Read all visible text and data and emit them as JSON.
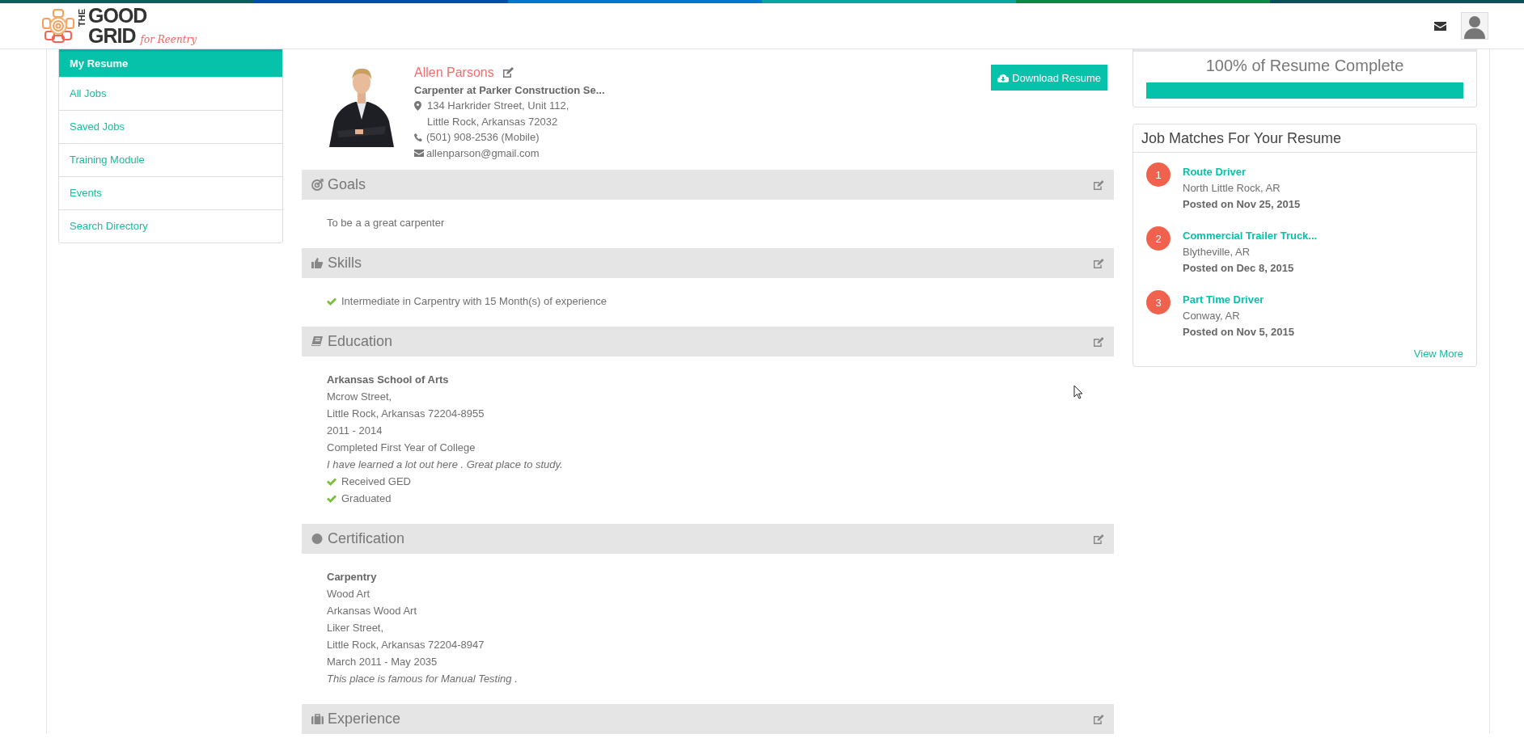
{
  "header": {
    "logo": {
      "word_1": "THE",
      "word_2": "GOOD",
      "word_3": "GRID",
      "tagline": "for Reentry"
    }
  },
  "sidebar": {
    "items": [
      {
        "label": "My Resume",
        "selected": true
      },
      {
        "label": "All Jobs",
        "selected": false
      },
      {
        "label": "Saved Jobs",
        "selected": false
      },
      {
        "label": "Training Module",
        "selected": false
      },
      {
        "label": "Events",
        "selected": false
      },
      {
        "label": "Search Directory",
        "selected": false
      }
    ]
  },
  "profile": {
    "name": "Allen Parsons",
    "headline": "Carpenter at Parker Construction Se...",
    "address_line_1": "134 Harkrider Street, Unit 112,",
    "address_line_2": "Little Rock, Arkansas  72032",
    "phone": "(501) 908-2536 (Mobile)",
    "email": "allenparson@gmail.com",
    "download_button": "Download Resume"
  },
  "sections": [
    {
      "kind": "goals",
      "title": "Goals",
      "entries": [
        {
          "kind": "plain",
          "text": "To be a a great carpenter"
        }
      ]
    },
    {
      "kind": "skills",
      "title": "Skills",
      "entries": [
        {
          "kind": "check",
          "text": "Intermediate in Carpentry with 15  Month(s) of experience"
        }
      ]
    },
    {
      "kind": "education",
      "title": "Education",
      "entries": [
        {
          "kind": "heading",
          "text": "Arkansas School of Arts"
        },
        {
          "kind": "plain",
          "text": "Mcrow Street,"
        },
        {
          "kind": "plain",
          "text": "Little Rock, Arkansas  72204-8955"
        },
        {
          "kind": "plain",
          "text": "2011 - 2014"
        },
        {
          "kind": "plain",
          "text": "Completed First Year of College"
        },
        {
          "kind": "note",
          "text": "I have learned a lot out here . Great place to study."
        },
        {
          "kind": "check",
          "text": "Received GED"
        },
        {
          "kind": "check",
          "text": "Graduated"
        }
      ]
    },
    {
      "kind": "certification",
      "title": "Certification",
      "entries": [
        {
          "kind": "heading",
          "text": "Carpentry"
        },
        {
          "kind": "plain",
          "text": "Wood Art"
        },
        {
          "kind": "plain",
          "text": "Arkansas Wood Art"
        },
        {
          "kind": "plain",
          "text": "Liker Street,"
        },
        {
          "kind": "plain",
          "text": "Little Rock, Arkansas  72204-8947"
        },
        {
          "kind": "plain",
          "text": "March 2011 - May 2035"
        },
        {
          "kind": "note",
          "text": "This place is famous for Manual Testing ."
        }
      ]
    },
    {
      "kind": "experience",
      "title": "Experience"
    }
  ],
  "resume_complete": {
    "label": "100% of Resume Complete",
    "level": 1
  },
  "job_matches": {
    "title": "Job Matches For Your Resume",
    "jobs": [
      {
        "number": "1",
        "title": "Route Driver",
        "location": "North Little Rock, AR",
        "posted": "Posted on Nov 25, 2015"
      },
      {
        "number": "2",
        "title": "Commercial Trailer Truck...",
        "location": "Blytheville, AR",
        "posted": "Posted on Dec 8, 2015"
      },
      {
        "number": "3",
        "title": "Part Time Driver",
        "location": "Conway, AR",
        "posted": "Posted on Nov 5, 2015"
      }
    ],
    "view_more": "View More"
  }
}
